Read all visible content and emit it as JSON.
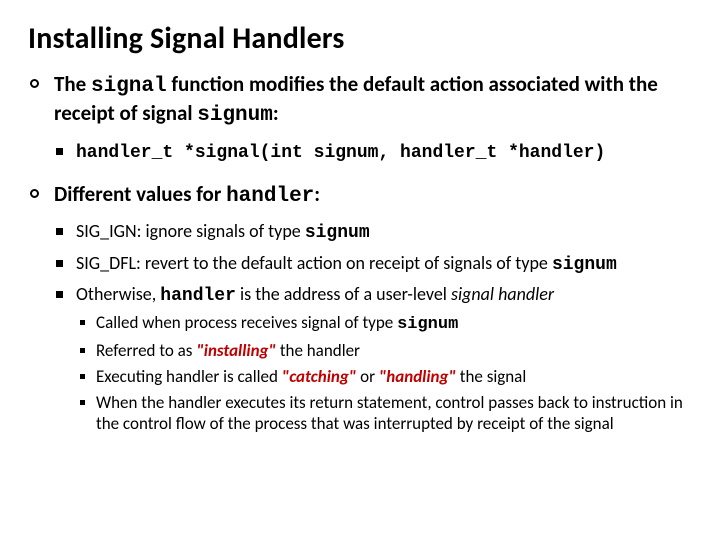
{
  "title": "Installing Signal Handlers",
  "b1": {
    "t1": "The ",
    "t2": "signal",
    "t3": " function modifies the default action associated with the receipt of signal ",
    "t4": "signum",
    "t5": ":",
    "code": "handler_t *signal(int signum, handler_t *handler)"
  },
  "b2": {
    "t1": "Different values for ",
    "t2": "handler",
    "t3": ":",
    "i1": {
      "a": "SIG_IGN: ignore signals of type ",
      "b": "signum"
    },
    "i2": {
      "a": "SIG_DFL: revert to the default action on receipt of signals of type ",
      "b": "signum"
    },
    "i3": {
      "a": "Otherwise, ",
      "b": "handler",
      "c": " is the address of a user-level ",
      "d": "signal handler",
      "s1": {
        "a": "Called when process receives signal of type ",
        "b": "signum"
      },
      "s2": {
        "a": "Referred to as ",
        "b": "\"installing\"",
        "c": " the handler"
      },
      "s3": {
        "a": "Executing handler is called ",
        "b": "\"catching\"",
        "c": " or ",
        "d": "\"handling\"",
        "e": " the signal"
      },
      "s4": "When the handler executes its return statement, control passes back to instruction in the control flow of the process that was interrupted by receipt of the signal"
    }
  }
}
